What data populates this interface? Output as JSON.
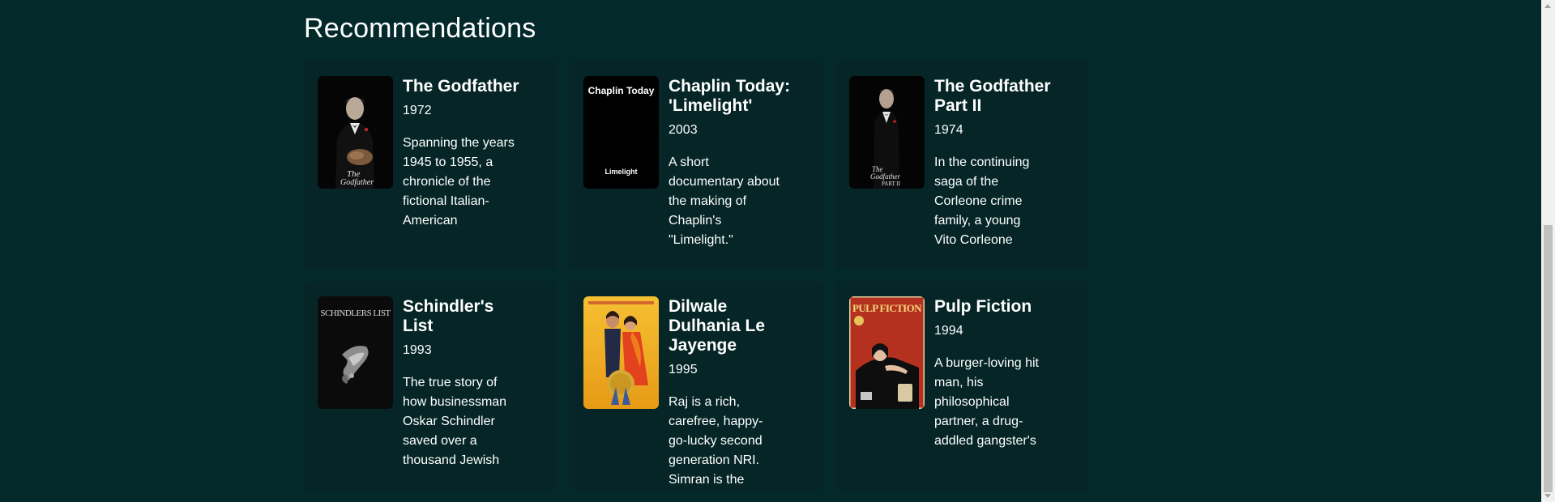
{
  "section": {
    "title": "Recommendations"
  },
  "movies": [
    {
      "title": "The Godfather",
      "year": "1972",
      "overview": "Spanning the years 1945 to 1955, a chronicle of the fictional Italian-American",
      "poster_text": ""
    },
    {
      "title": "Chaplin Today: 'Limelight'",
      "year": "2003",
      "overview": "A short documentary about the making of Chaplin's \"Limelight.\"",
      "poster_text_top": "Chaplin Today",
      "poster_text_bottom": "Limelight"
    },
    {
      "title": "The Godfather Part II",
      "year": "1974",
      "overview": "In the continuing saga of the Corleone crime family, a young Vito Corleone",
      "poster_text": ""
    },
    {
      "title": "Schindler's List",
      "year": "1993",
      "overview": "The true story of how businessman Oskar Schindler saved over a thousand Jewish",
      "poster_text": "SCHINDLERS LIST"
    },
    {
      "title": "Dilwale Dulhania Le Jayenge",
      "year": "1995",
      "overview": "Raj is a rich, carefree, happy-go-lucky second generation NRI. Simran is the",
      "poster_text": ""
    },
    {
      "title": "Pulp Fiction",
      "year": "1994",
      "overview": "A burger-loving hit man, his philosophical partner, a drug-addled gangster's",
      "poster_text": "PULP FICTION"
    }
  ],
  "colors": {
    "background": "#04292b",
    "card": "#052526",
    "text": "#ffffff"
  }
}
